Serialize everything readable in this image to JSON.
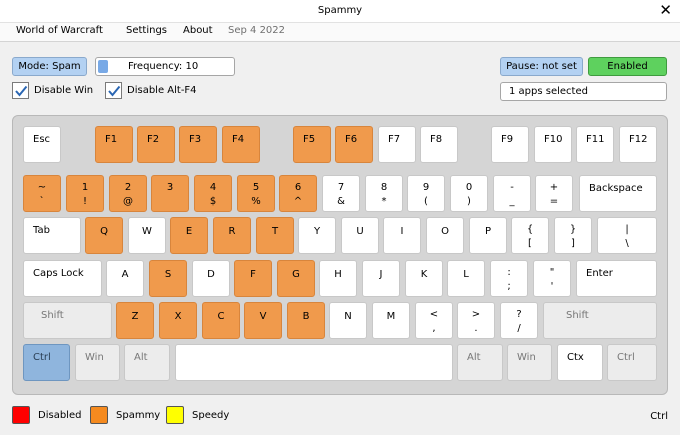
{
  "window": {
    "title": "Spammy",
    "close_glyph": "✕"
  },
  "menu": {
    "items": [
      "World of Warcraft",
      "Settings",
      "About"
    ],
    "date": "Sep  4 2022"
  },
  "controls": {
    "mode_label": "Mode: Spam",
    "frequency_label": "Frequency: 10",
    "pause_label": "Pause: not set",
    "enabled_label": "Enabled",
    "apps_label": "1 apps selected",
    "disable_win_label": "Disable Win",
    "disable_win_checked": true,
    "disable_altf4_label": "Disable Alt-F4",
    "disable_altf4_checked": true
  },
  "colors": {
    "spam": "#f09a4c",
    "accent_blue": "#b3d1f2",
    "enabled_green": "#5ed15e",
    "disabled_red": "#ff0000",
    "speedy_yellow": "#ffff00"
  },
  "keyboard": {
    "row_fn": [
      {
        "label": "Esc",
        "state": "white"
      },
      {
        "label": "F1",
        "state": "orange"
      },
      {
        "label": "F2",
        "state": "orange"
      },
      {
        "label": "F3",
        "state": "orange"
      },
      {
        "label": "F4",
        "state": "orange"
      },
      {
        "label": "F5",
        "state": "orange"
      },
      {
        "label": "F6",
        "state": "orange"
      },
      {
        "label": "F7",
        "state": "white"
      },
      {
        "label": "F8",
        "state": "white"
      },
      {
        "label": "F9",
        "state": "white"
      },
      {
        "label": "F10",
        "state": "white"
      },
      {
        "label": "F11",
        "state": "white"
      },
      {
        "label": "F12",
        "state": "white"
      }
    ],
    "row_num": [
      {
        "top": "~",
        "bottom": "`",
        "state": "orange"
      },
      {
        "top": "1",
        "bottom": "!",
        "state": "orange"
      },
      {
        "top": "2",
        "bottom": "@",
        "state": "orange"
      },
      {
        "top": "3",
        "bottom": "",
        "state": "orange"
      },
      {
        "top": "4",
        "bottom": "$",
        "state": "orange"
      },
      {
        "top": "5",
        "bottom": "%",
        "state": "orange"
      },
      {
        "top": "6",
        "bottom": "^",
        "state": "orange"
      },
      {
        "top": "7",
        "bottom": "&",
        "state": "white"
      },
      {
        "top": "8",
        "bottom": "*",
        "state": "white"
      },
      {
        "top": "9",
        "bottom": "(",
        "state": "white"
      },
      {
        "top": "0",
        "bottom": ")",
        "state": "white"
      },
      {
        "top": "-",
        "bottom": "_",
        "state": "white"
      },
      {
        "top": "+",
        "bottom": "=",
        "state": "white"
      },
      {
        "top": "Backspace",
        "bottom": "",
        "state": "white"
      }
    ],
    "row_q": [
      {
        "top": "Tab",
        "bottom": "",
        "state": "white"
      },
      {
        "top": "Q",
        "bottom": "",
        "state": "orange"
      },
      {
        "top": "W",
        "bottom": "",
        "state": "white"
      },
      {
        "top": "E",
        "bottom": "",
        "state": "orange"
      },
      {
        "top": "R",
        "bottom": "",
        "state": "orange"
      },
      {
        "top": "T",
        "bottom": "",
        "state": "orange"
      },
      {
        "top": "Y",
        "bottom": "",
        "state": "white"
      },
      {
        "top": "U",
        "bottom": "",
        "state": "white"
      },
      {
        "top": "I",
        "bottom": "",
        "state": "white"
      },
      {
        "top": "O",
        "bottom": "",
        "state": "white"
      },
      {
        "top": "P",
        "bottom": "",
        "state": "white"
      },
      {
        "top": "{",
        "bottom": "[",
        "state": "white"
      },
      {
        "top": "}",
        "bottom": "]",
        "state": "white"
      },
      {
        "top": "|",
        "bottom": "\\",
        "state": "white"
      }
    ],
    "row_a": [
      {
        "top": "Caps Lock",
        "bottom": "",
        "state": "white"
      },
      {
        "top": "A",
        "bottom": "",
        "state": "white"
      },
      {
        "top": "S",
        "bottom": "",
        "state": "orange"
      },
      {
        "top": "D",
        "bottom": "",
        "state": "white"
      },
      {
        "top": "F",
        "bottom": "",
        "state": "orange"
      },
      {
        "top": "G",
        "bottom": "",
        "state": "orange"
      },
      {
        "top": "H",
        "bottom": "",
        "state": "white"
      },
      {
        "top": "J",
        "bottom": "",
        "state": "white"
      },
      {
        "top": "K",
        "bottom": "",
        "state": "white"
      },
      {
        "top": "L",
        "bottom": "",
        "state": "white"
      },
      {
        "top": ":",
        "bottom": ";",
        "state": "white"
      },
      {
        "top": "\"",
        "bottom": "'",
        "state": "white"
      },
      {
        "top": "Enter",
        "bottom": "",
        "state": "white"
      }
    ],
    "row_z": [
      {
        "top": "Shift",
        "bottom": "",
        "state": "gray"
      },
      {
        "top": "Z",
        "bottom": "",
        "state": "orange"
      },
      {
        "top": "X",
        "bottom": "",
        "state": "orange"
      },
      {
        "top": "C",
        "bottom": "",
        "state": "orange"
      },
      {
        "top": "V",
        "bottom": "",
        "state": "orange"
      },
      {
        "top": "B",
        "bottom": "",
        "state": "orange"
      },
      {
        "top": "N",
        "bottom": "",
        "state": "white"
      },
      {
        "top": "M",
        "bottom": "",
        "state": "white"
      },
      {
        "top": "<",
        "bottom": ",",
        "state": "white"
      },
      {
        "top": ">",
        "bottom": ".",
        "state": "white"
      },
      {
        "top": "?",
        "bottom": "/",
        "state": "white"
      },
      {
        "top": "Shift",
        "bottom": "",
        "state": "gray"
      }
    ],
    "row_bottom": [
      {
        "top": "Ctrl",
        "bottom": "",
        "state": "blue"
      },
      {
        "top": "Win",
        "bottom": "",
        "state": "gray"
      },
      {
        "top": "Alt",
        "bottom": "",
        "state": "gray"
      },
      {
        "top": "",
        "bottom": "",
        "state": "white"
      },
      {
        "top": "Alt",
        "bottom": "",
        "state": "gray"
      },
      {
        "top": "Win",
        "bottom": "",
        "state": "gray"
      },
      {
        "top": "Ctx",
        "bottom": "",
        "state": "white"
      },
      {
        "top": "Ctrl",
        "bottom": "",
        "state": "gray"
      }
    ]
  },
  "legend": [
    {
      "label": "Disabled",
      "color": "#ff0000"
    },
    {
      "label": "Spammy",
      "color": "#f58a1f"
    },
    {
      "label": "Speedy",
      "color": "#ffff00"
    }
  ],
  "status_key": "Ctrl"
}
